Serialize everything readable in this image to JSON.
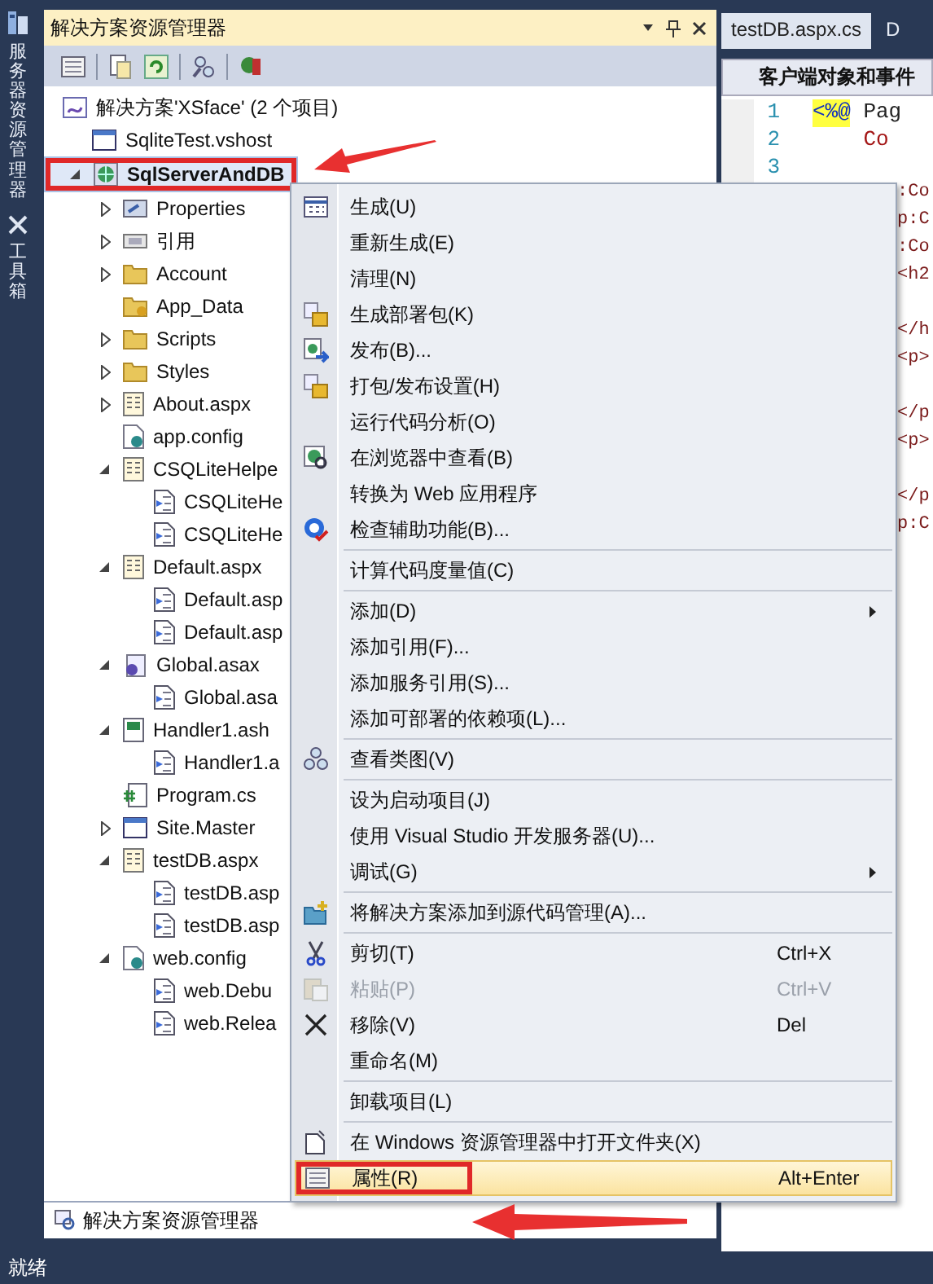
{
  "side_strip": [
    {
      "label": "服务器资源管理器",
      "kind": "server"
    },
    {
      "label": "工具箱",
      "kind": "toolbox"
    }
  ],
  "explorer": {
    "title": "解决方案资源管理器",
    "tree": {
      "label": "解决方案'XSface' (2 个项目)",
      "kind": "solution",
      "children": [
        {
          "label": "SqliteTest.vshost",
          "kind": "window",
          "selected": false
        },
        {
          "label": "SqlServerAndDB",
          "kind": "web-project",
          "expanded": true,
          "selected": true,
          "annotated": true,
          "children": [
            {
              "label": "Properties",
              "kind": "properties",
              "expanded": false,
              "selected": false
            },
            {
              "label": "引用",
              "kind": "references",
              "expanded": false,
              "selected": false
            },
            {
              "label": "Account",
              "kind": "folder",
              "expanded": false,
              "selected": false
            },
            {
              "label": "App_Data",
              "kind": "data-folder",
              "selected": false
            },
            {
              "label": "Scripts",
              "kind": "folder",
              "expanded": false,
              "selected": false
            },
            {
              "label": "Styles",
              "kind": "folder",
              "expanded": false,
              "selected": false
            },
            {
              "label": "About.aspx",
              "kind": "page",
              "expanded": false,
              "selected": false
            },
            {
              "label": "app.config",
              "kind": "config",
              "selected": false
            },
            {
              "label": "CSQLiteHelpe",
              "kind": "page",
              "expanded": true,
              "selected": false,
              "children": [
                {
                  "label": "CSQLiteHe",
                  "kind": "code",
                  "selected": false
                },
                {
                  "label": "CSQLiteHe",
                  "kind": "code",
                  "selected": false
                }
              ]
            },
            {
              "label": "Default.aspx",
              "kind": "page",
              "expanded": true,
              "selected": false,
              "children": [
                {
                  "label": "Default.asp",
                  "kind": "code",
                  "selected": false
                },
                {
                  "label": "Default.asp",
                  "kind": "code",
                  "selected": false
                }
              ]
            },
            {
              "label": "Global.asax",
              "kind": "global",
              "expanded": true,
              "selected": false,
              "children": [
                {
                  "label": "Global.asa",
                  "kind": "code",
                  "selected": false
                }
              ]
            },
            {
              "label": "Handler1.ash",
              "kind": "handler",
              "expanded": true,
              "selected": false,
              "children": [
                {
                  "label": "Handler1.a",
                  "kind": "code",
                  "selected": false
                }
              ]
            },
            {
              "label": "Program.cs",
              "kind": "csharp",
              "selected": false
            },
            {
              "label": "Site.Master",
              "kind": "window",
              "expanded": false,
              "selected": false
            },
            {
              "label": "testDB.aspx",
              "kind": "page",
              "expanded": true,
              "selected": false,
              "children": [
                {
                  "label": "testDB.asp",
                  "kind": "code",
                  "selected": false
                },
                {
                  "label": "testDB.asp",
                  "kind": "code",
                  "selected": false
                }
              ]
            },
            {
              "label": "web.config",
              "kind": "config",
              "expanded": true,
              "selected": false,
              "children": [
                {
                  "label": "web.Debu",
                  "kind": "code",
                  "selected": false
                },
                {
                  "label": "web.Relea",
                  "kind": "code",
                  "selected": false
                }
              ]
            }
          ]
        }
      ]
    },
    "bottom_tabs": [
      {
        "label": "解决方案资源管理器",
        "selected": true
      }
    ]
  },
  "editor": {
    "tabs": [
      {
        "label": "testDB.aspx.cs",
        "selected": true
      },
      {
        "label": "D",
        "selected": false
      }
    ],
    "object_list": "客户端对象和事件",
    "lines": [
      {
        "number": "1",
        "segments": [
          {
            "text": "<%@",
            "kind": "delimiter"
          },
          {
            "text": " Pag",
            "kind": "plain"
          }
        ]
      },
      {
        "number": "2",
        "segments": [
          {
            "text": "    Co",
            "kind": "attribute"
          }
        ]
      },
      {
        "number": "3"
      }
    ],
    "fragments": [
      [
        ":Co",
        "p:C",
        ":Co",
        "<h2"
      ],
      [
        "</h",
        "<p>"
      ],
      [
        "</p",
        "<p>"
      ],
      [
        "</p",
        "p:C"
      ]
    ]
  },
  "context_menu": [
    {
      "kind": "item",
      "label": "生成(U)"
    },
    {
      "kind": "item",
      "label": "重新生成(E)"
    },
    {
      "kind": "item",
      "label": "清理(N)"
    },
    {
      "kind": "item",
      "label": "生成部署包(K)"
    },
    {
      "kind": "item",
      "label": "发布(B)..."
    },
    {
      "kind": "item",
      "label": "打包/发布设置(H)"
    },
    {
      "kind": "item",
      "label": "运行代码分析(O)"
    },
    {
      "kind": "item",
      "label": "在浏览器中查看(B)"
    },
    {
      "kind": "item",
      "label": "转换为 Web 应用程序"
    },
    {
      "kind": "item",
      "label": "检查辅助功能(B)..."
    },
    {
      "kind": "separator"
    },
    {
      "kind": "item",
      "label": "计算代码度量值(C)"
    },
    {
      "kind": "separator"
    },
    {
      "kind": "item",
      "label": "添加(D)",
      "submenu": true
    },
    {
      "kind": "item",
      "label": "添加引用(F)..."
    },
    {
      "kind": "item",
      "label": "添加服务引用(S)..."
    },
    {
      "kind": "item",
      "label": "添加可部署的依赖项(L)..."
    },
    {
      "kind": "separator"
    },
    {
      "kind": "item",
      "label": "查看类图(V)"
    },
    {
      "kind": "separator"
    },
    {
      "kind": "item",
      "label": "设为启动项目(J)"
    },
    {
      "kind": "item",
      "label": "使用 Visual Studio 开发服务器(U)..."
    },
    {
      "kind": "item",
      "label": "调试(G)",
      "submenu": true
    },
    {
      "kind": "separator"
    },
    {
      "kind": "item",
      "label": "将解决方案添加到源代码管理(A)..."
    },
    {
      "kind": "separator"
    },
    {
      "kind": "item",
      "label": "剪切(T)",
      "shortcut": "Ctrl+X",
      "disabled": false
    },
    {
      "kind": "item",
      "label": "粘贴(P)",
      "shortcut": "Ctrl+V",
      "disabled": true
    },
    {
      "kind": "item",
      "label": "移除(V)",
      "shortcut": "Del",
      "disabled": false
    },
    {
      "kind": "item",
      "label": "重命名(M)"
    },
    {
      "kind": "separator"
    },
    {
      "kind": "item",
      "label": "卸载项目(L)"
    },
    {
      "kind": "separator"
    },
    {
      "kind": "item",
      "label": "在 Windows 资源管理器中打开文件夹(X)"
    },
    {
      "kind": "item",
      "label": "属性(R)",
      "shortcut": "Alt+Enter",
      "highlighted": true,
      "annotated": true
    }
  ],
  "status_bar": {
    "text": "就绪"
  }
}
